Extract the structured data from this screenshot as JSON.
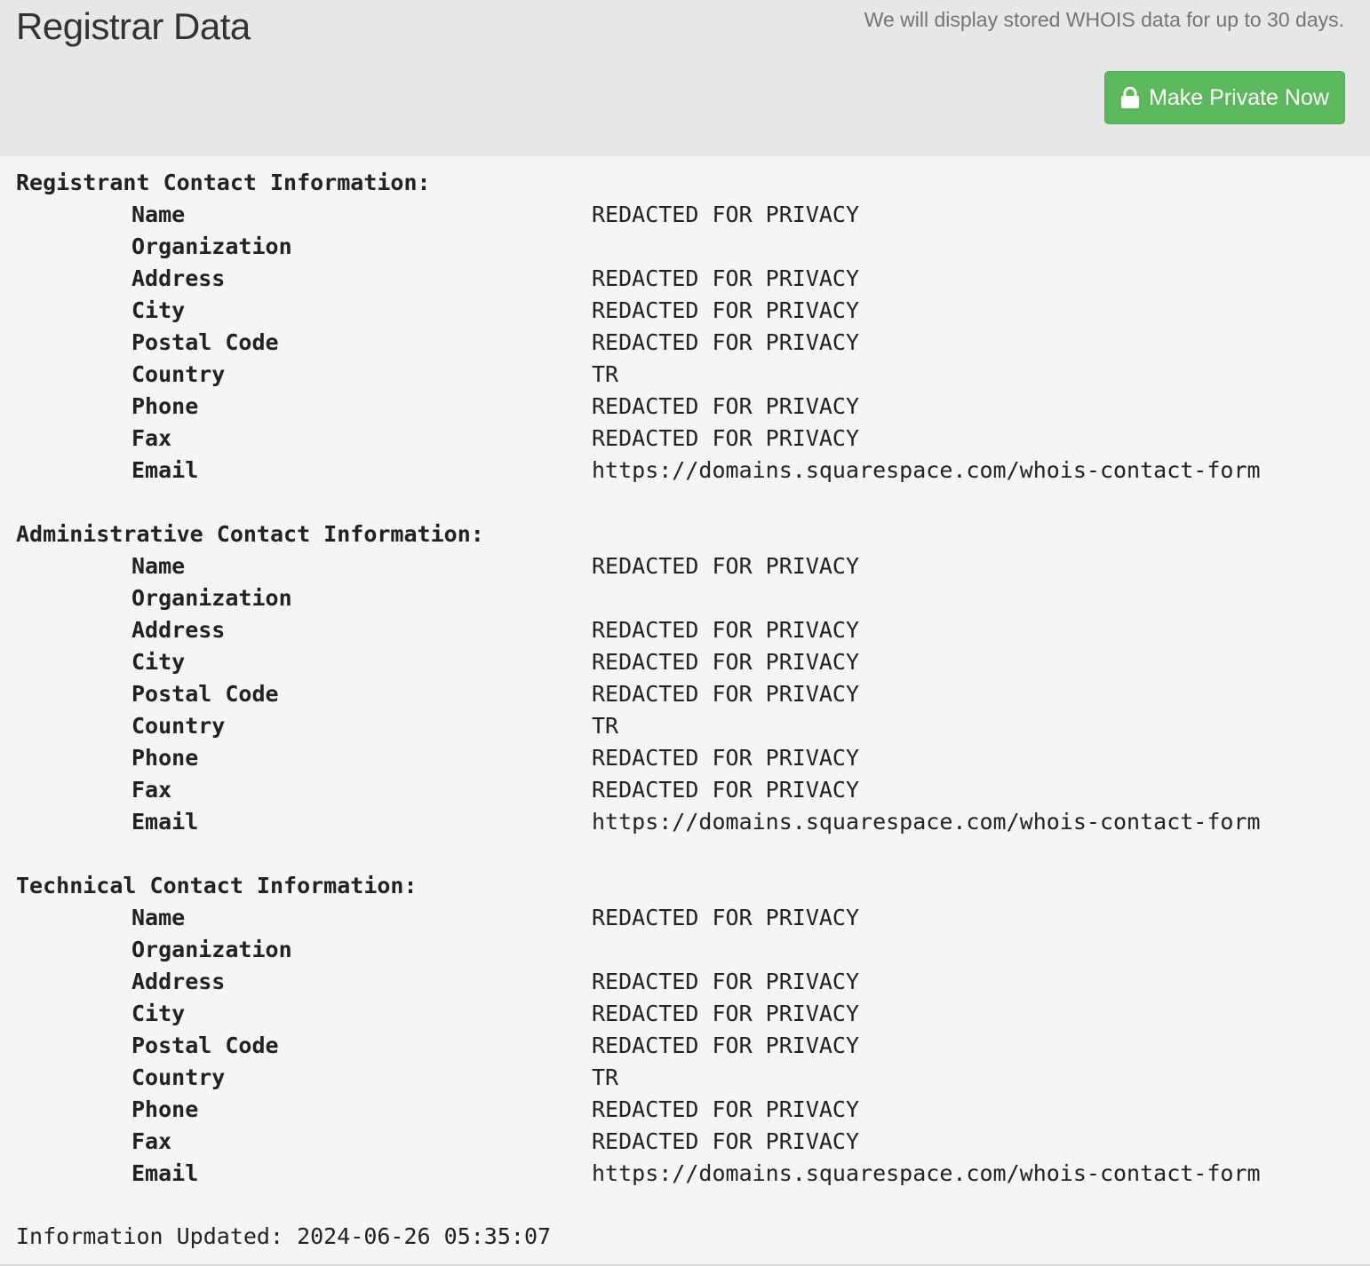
{
  "header": {
    "title": "Registrar Data",
    "notice": "We will display stored WHOIS data for up to 30 days.",
    "private_button_label": "Make Private Now",
    "private_button_icon": "lock-icon",
    "private_button_color": "#5cb85c"
  },
  "sections": [
    {
      "heading": "Registrant Contact Information:",
      "fields": [
        {
          "label": "Name",
          "value": "REDACTED FOR PRIVACY"
        },
        {
          "label": "Organization",
          "value": ""
        },
        {
          "label": "Address",
          "value": "REDACTED FOR PRIVACY"
        },
        {
          "label": "City",
          "value": "REDACTED FOR PRIVACY"
        },
        {
          "label": "Postal Code",
          "value": "REDACTED FOR PRIVACY"
        },
        {
          "label": "Country",
          "value": "TR"
        },
        {
          "label": "Phone",
          "value": "REDACTED FOR PRIVACY"
        },
        {
          "label": "Fax",
          "value": "REDACTED FOR PRIVACY"
        },
        {
          "label": "Email",
          "value": "https://domains.squarespace.com/whois-contact-form"
        }
      ]
    },
    {
      "heading": "Administrative Contact Information:",
      "fields": [
        {
          "label": "Name",
          "value": "REDACTED FOR PRIVACY"
        },
        {
          "label": "Organization",
          "value": ""
        },
        {
          "label": "Address",
          "value": "REDACTED FOR PRIVACY"
        },
        {
          "label": "City",
          "value": "REDACTED FOR PRIVACY"
        },
        {
          "label": "Postal Code",
          "value": "REDACTED FOR PRIVACY"
        },
        {
          "label": "Country",
          "value": "TR"
        },
        {
          "label": "Phone",
          "value": "REDACTED FOR PRIVACY"
        },
        {
          "label": "Fax",
          "value": "REDACTED FOR PRIVACY"
        },
        {
          "label": "Email",
          "value": "https://domains.squarespace.com/whois-contact-form"
        }
      ]
    },
    {
      "heading": "Technical Contact Information:",
      "fields": [
        {
          "label": "Name",
          "value": "REDACTED FOR PRIVACY"
        },
        {
          "label": "Organization",
          "value": ""
        },
        {
          "label": "Address",
          "value": "REDACTED FOR PRIVACY"
        },
        {
          "label": "City",
          "value": "REDACTED FOR PRIVACY"
        },
        {
          "label": "Postal Code",
          "value": "REDACTED FOR PRIVACY"
        },
        {
          "label": "Country",
          "value": "TR"
        },
        {
          "label": "Phone",
          "value": "REDACTED FOR PRIVACY"
        },
        {
          "label": "Fax",
          "value": "REDACTED FOR PRIVACY"
        },
        {
          "label": "Email",
          "value": "https://domains.squarespace.com/whois-contact-form"
        }
      ]
    }
  ],
  "footer": {
    "updated_text": "Information Updated: 2024-06-26 05:35:07"
  }
}
